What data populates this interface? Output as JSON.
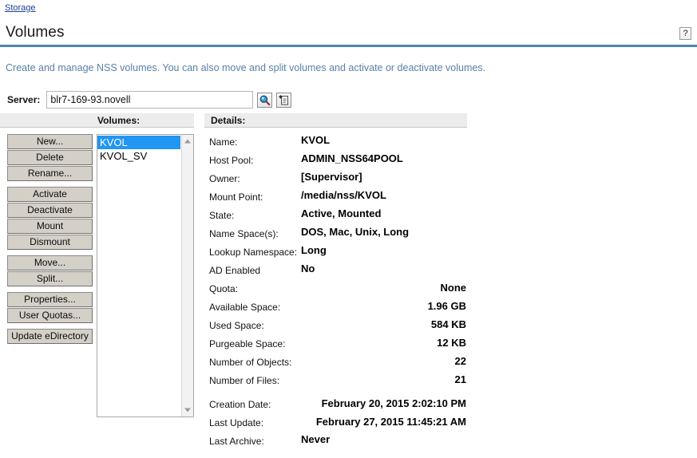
{
  "breadcrumb": {
    "items": [
      {
        "label": "Storage"
      }
    ]
  },
  "header": {
    "title": "Volumes",
    "help_label": "?",
    "description": "Create and manage NSS volumes. You can also move and split volumes and activate or deactivate volumes.",
    "accent_color": "#4a87b8",
    "link_color": "#1b3f94",
    "description_color": "#5b7fa6"
  },
  "server": {
    "label": "Server:",
    "value": "blr7-169-93.novell",
    "placeholder": "",
    "search_icon": "magnifier-icon",
    "object_selector_icon": "object-selector-icon"
  },
  "volumes_panel": {
    "header": "Volumes:",
    "items": [
      {
        "label": "KVOL",
        "selected": true
      },
      {
        "label": "KVOL_SV",
        "selected": false
      }
    ],
    "selected_index": 0,
    "selection_color": "#2196f3"
  },
  "buttons": [
    {
      "label": "New...",
      "group": 0
    },
    {
      "label": "Delete",
      "group": 0
    },
    {
      "label": "Rename...",
      "group": 0
    },
    {
      "label": "Activate",
      "group": 1
    },
    {
      "label": "Deactivate",
      "group": 1
    },
    {
      "label": "Mount",
      "group": 1
    },
    {
      "label": "Dismount",
      "group": 1
    },
    {
      "label": "Move...",
      "group": 2
    },
    {
      "label": "Split...",
      "group": 2
    },
    {
      "label": "Properties...",
      "group": 3
    },
    {
      "label": "User Quotas...",
      "group": 3
    },
    {
      "label": "Update eDirectory",
      "group": 4
    }
  ],
  "details": {
    "header": "Details:",
    "rows": [
      {
        "label": "Name:",
        "value": "KVOL",
        "align": "left",
        "gap": false
      },
      {
        "label": "Host Pool:",
        "value": "ADMIN_NSS64POOL",
        "align": "left",
        "gap": false
      },
      {
        "label": "Owner:",
        "value": "[Supervisor]",
        "align": "left",
        "gap": false
      },
      {
        "label": "Mount Point:",
        "value": "/media/nss/KVOL",
        "align": "left",
        "gap": false
      },
      {
        "label": "State:",
        "value": "Active, Mounted",
        "align": "left",
        "gap": false
      },
      {
        "label": "Name Space(s):",
        "value": "DOS, Mac, Unix, Long",
        "align": "left",
        "gap": false
      },
      {
        "label": "Lookup Namespace:",
        "value": "Long",
        "align": "left",
        "gap": false
      },
      {
        "label": "AD Enabled",
        "value": "No",
        "align": "left",
        "gap": false
      },
      {
        "label": "Quota:",
        "value": "None",
        "align": "right",
        "gap": false
      },
      {
        "label": "Available Space:",
        "value": "1.96 GB",
        "align": "right",
        "gap": false
      },
      {
        "label": "Used Space:",
        "value": "584 KB",
        "align": "right",
        "gap": false
      },
      {
        "label": "Purgeable Space:",
        "value": "12 KB",
        "align": "right",
        "gap": false
      },
      {
        "label": "Number of Objects:",
        "value": "22",
        "align": "right",
        "gap": false
      },
      {
        "label": "Number of Files:",
        "value": "21",
        "align": "right",
        "gap": false
      },
      {
        "label": "Creation Date:",
        "value": "February 20, 2015 2:02:10 PM",
        "align": "right",
        "gap": true
      },
      {
        "label": "Last Update:",
        "value": "February 27, 2015 11:45:21 AM",
        "align": "right",
        "gap": false
      },
      {
        "label": "Last Archive:",
        "value": "Never",
        "align": "left",
        "gap": false
      }
    ]
  }
}
